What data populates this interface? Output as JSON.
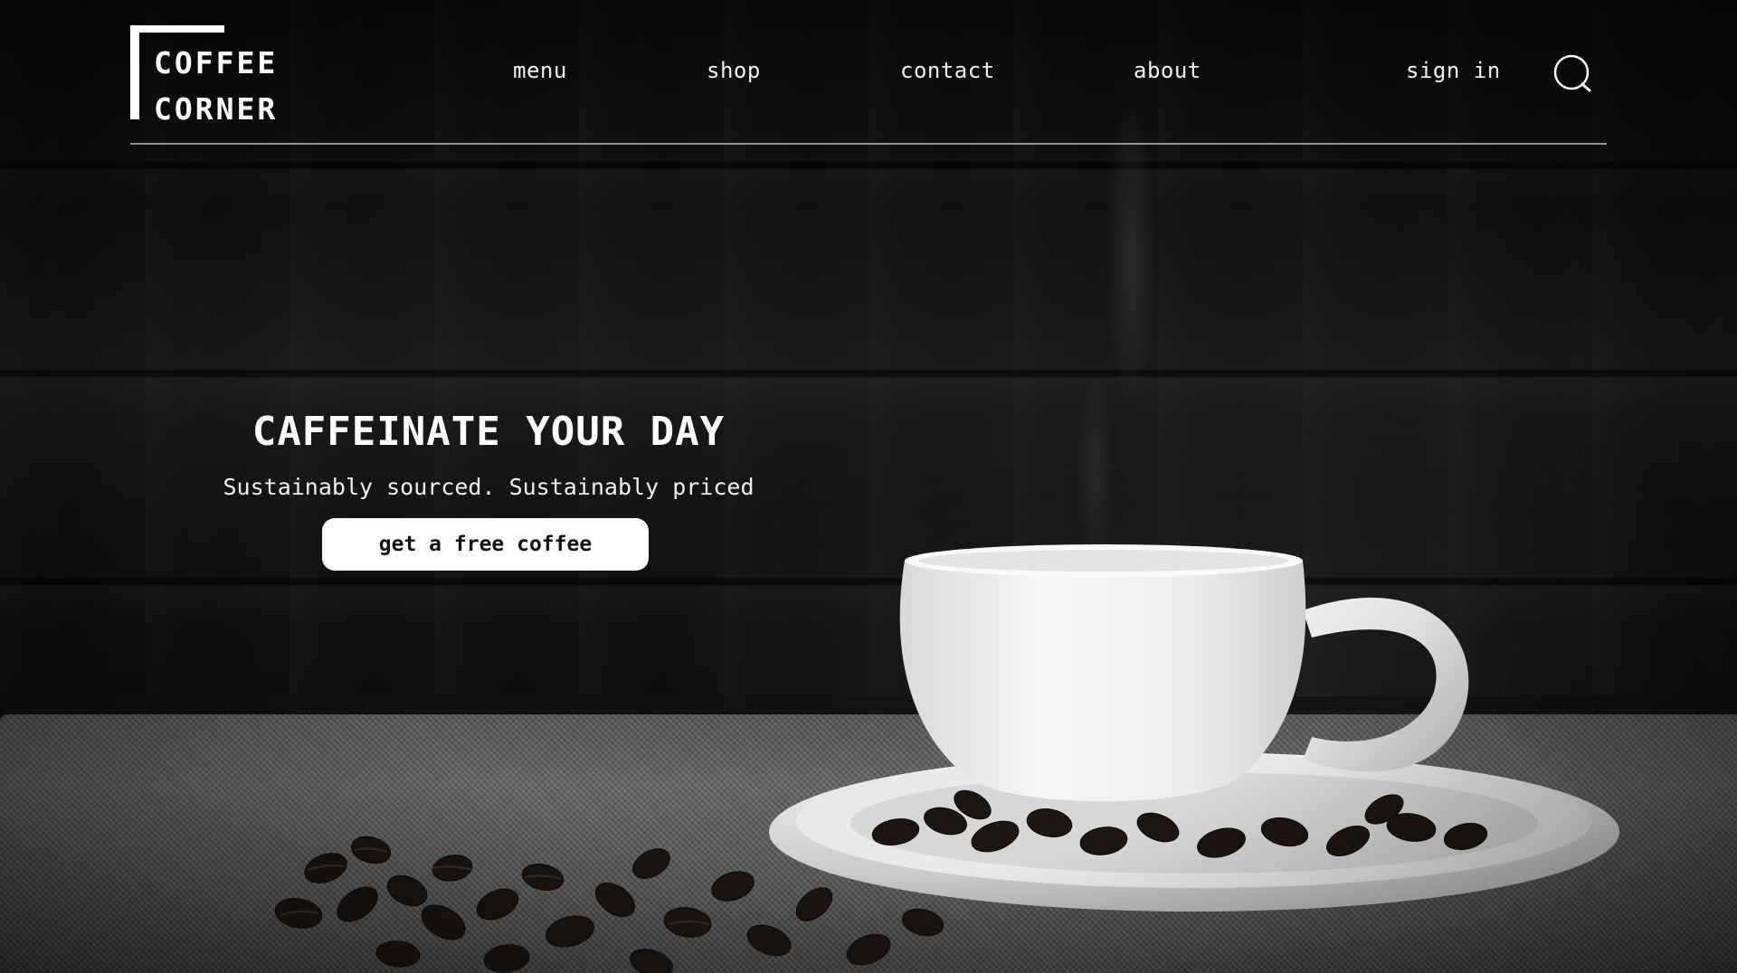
{
  "brand": {
    "line1": "COFFEE",
    "line2": "CORNER"
  },
  "nav": {
    "items": [
      {
        "label": "menu"
      },
      {
        "label": "shop"
      },
      {
        "label": "contact"
      },
      {
        "label": "about"
      }
    ],
    "sign_in": "sign in",
    "search_icon": "search-icon"
  },
  "hero": {
    "title": "CAFFEINATE YOUR DAY",
    "subtitle": "Sustainably sourced. Sustainably priced",
    "cta_label": "get a free coffee"
  },
  "image": {
    "subject": "coffee-cup-with-beans",
    "style": "grayscale"
  }
}
